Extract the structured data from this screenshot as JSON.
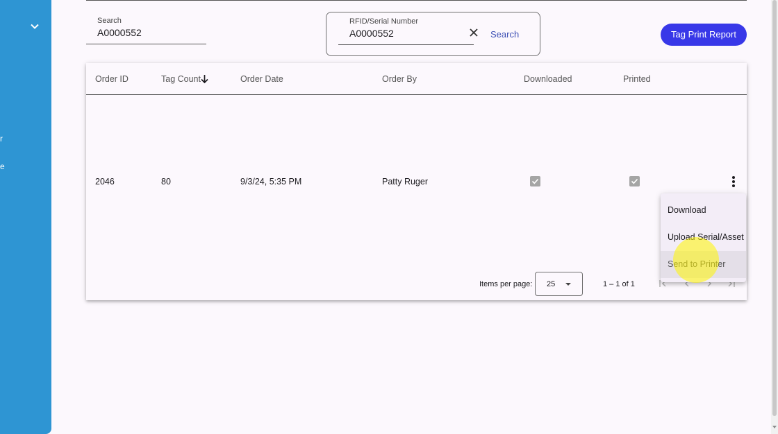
{
  "sidebar": {
    "stub_1": "r",
    "stub_2": "e"
  },
  "search": {
    "label": "Search",
    "value": "A0000552"
  },
  "rfid": {
    "label": "RFID/Serial Number",
    "value": "A0000552",
    "search_label": "Search"
  },
  "toolbar": {
    "tag_print_report_label": "Tag Print Report"
  },
  "table": {
    "headers": {
      "order_id": "Order ID",
      "tag_count": "Tag Count",
      "order_date": "Order Date",
      "order_by": "Order By",
      "downloaded": "Downloaded",
      "printed": "Printed"
    },
    "sort_icon": "arrow-down-icon",
    "rows": [
      {
        "order_id": "2046",
        "tag_count": "80",
        "order_date": "9/3/24, 5:35 PM",
        "order_by": "Patty Ruger",
        "downloaded": true,
        "printed": true
      }
    ]
  },
  "pagination": {
    "items_per_page_label": "Items per page:",
    "items_per_page": "25",
    "range": "1 – 1 of 1"
  },
  "row_menu": {
    "items": [
      "Download",
      "Upload Serial/Asset",
      "Send to Printer"
    ],
    "highlighted": "Send to Printer"
  },
  "colors": {
    "sidebar": "#2e95d3",
    "primary_button": "#3838e8",
    "link": "#3f51b5",
    "checkbox_disabled": "#a5a5a5",
    "cursor_highlight": "#fff500"
  }
}
